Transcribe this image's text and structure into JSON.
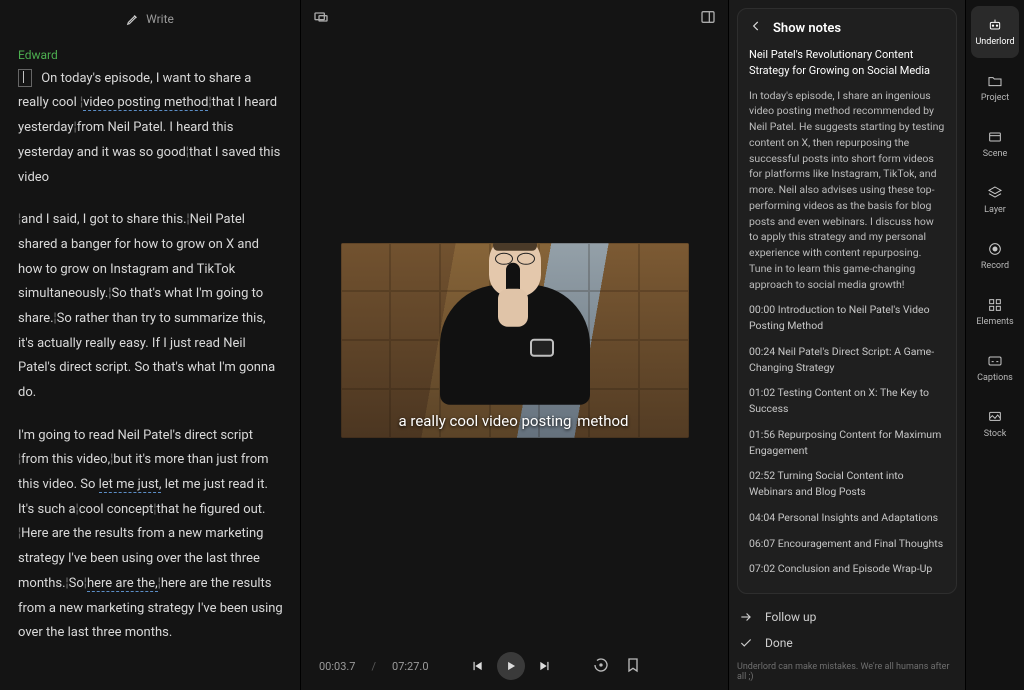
{
  "header": {
    "write_label": "Write"
  },
  "script": {
    "speaker": "Edward",
    "p1_a": "On today's episode, I want to share a really cool",
    "p1_u1": "video posting method",
    "p1_b": "that I heard yesterday",
    "p1_c": "from Neil Patel. I heard this yesterday and it was so good",
    "p1_d": "that I saved this video",
    "p2_a": "and I said, I got to share this.",
    "p2_b": "Neil Patel shared a banger for how to grow on X and how to grow on Instagram and TikTok simultaneously.",
    "p2_c": "So that's what I'm going to share.",
    "p2_d": "So rather than try to summarize this, it's actually really easy. If I just read Neil Patel's direct script. So that's what I'm gonna do.",
    "p3_a": "I'm going to read Neil Patel's direct script",
    "p3_b": "from this video,",
    "p3_c": "but it's more than just from this video. So ",
    "p3_u1": "let me just,",
    "p3_d": " let me just read it. It's such a",
    "p3_e": "cool concept",
    "p3_f": "that he figured out.",
    "p3_g": "Here are the results from a new marketing strategy I've been using over the last three months.",
    "p3_h": "So",
    "p3_u2": "here are the,",
    "p3_i": "here are the results from a new marketing strategy I've been using over the last three months."
  },
  "video": {
    "caption_plain": "a really cool video posting ",
    "caption_hl": "method"
  },
  "transport": {
    "current": "00:03.7",
    "sep": "/",
    "total": "07:27.0"
  },
  "notes": {
    "panel_title": "Show notes",
    "title": "Neil Patel's Revolutionary Content Strategy for Growing on Social Media",
    "body": "In today's episode, I share an ingenious video posting method recommended by Neil Patel. He suggests starting by testing content on X, then repurposing the successful posts into short form videos for platforms like Instagram, TikTok, and more. Neil also advises using these top-performing videos as the basis for blog posts and even webinars. I discuss how to apply this strategy and my personal experience with content repurposing. Tune in to learn this game-changing approach to social media growth!",
    "chapters": [
      "00:00 Introduction to Neil Patel's Video Posting Method",
      "00:24 Neil Patel's Direct Script: A Game-Changing Strategy",
      "01:02 Testing Content on X: The Key to Success",
      "01:56 Repurposing Content for Maximum Engagement",
      "02:52 Turning Social Content into Webinars and Blog Posts",
      "04:04 Personal Insights and Adaptations",
      "06:07 Encouragement and Final Thoughts",
      "07:02 Conclusion and Episode Wrap-Up"
    ],
    "followup": "Follow up",
    "done": "Done",
    "disclaimer": "Underlord can make mistakes. We're all humans after all ;)"
  },
  "rail": {
    "items": [
      {
        "label": "Underlord"
      },
      {
        "label": "Project"
      },
      {
        "label": "Scene"
      },
      {
        "label": "Layer"
      },
      {
        "label": "Record"
      },
      {
        "label": "Elements"
      },
      {
        "label": "Captions"
      },
      {
        "label": "Stock"
      }
    ]
  }
}
